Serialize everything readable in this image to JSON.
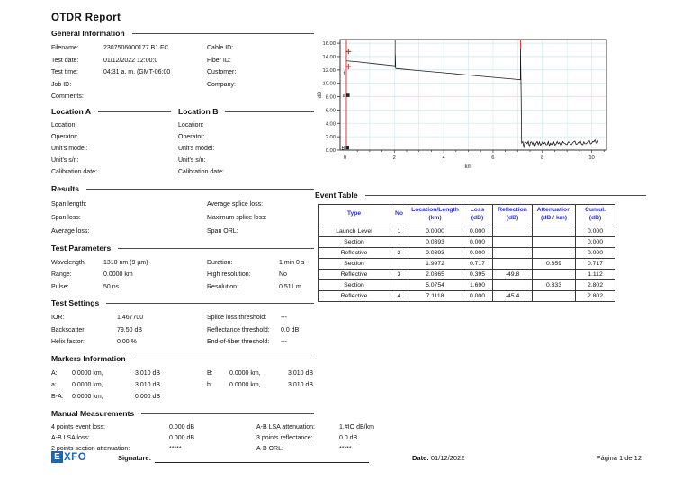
{
  "page": {
    "title": "OTDR  Report"
  },
  "sections": {
    "general": {
      "heading": "General Information",
      "rows": [
        {
          "l1": "Filename:",
          "v1": "2307506000177 B1 FC",
          "l2": "Cable ID:",
          "v2": ""
        },
        {
          "l1": "Test date:",
          "v1": "01/12/2022 12:00:0",
          "l2": "Fiber ID:",
          "v2": ""
        },
        {
          "l1": "Test time:",
          "v1": "04:31 a. m. (GMT-06:00",
          "l2": "Customer:",
          "v2": ""
        },
        {
          "l1": "Job ID:",
          "v1": "",
          "l2": "Company:",
          "v2": ""
        },
        {
          "l1": "Comments:",
          "v1": "",
          "l2": "",
          "v2": ""
        }
      ]
    },
    "location_a": {
      "heading": "Location A",
      "labels": [
        "Location:",
        "Operator:",
        "Unit's model:",
        "Unit's s/n:",
        "Calibration date:"
      ]
    },
    "location_b": {
      "heading": "Location B",
      "labels": [
        "Location:",
        "Operator:",
        "Unit's model:",
        "Unit's s/n:",
        "Calibration date:"
      ]
    },
    "results": {
      "heading": "Results",
      "rows": [
        {
          "l1": "Span length:",
          "l2": "Average splice loss:"
        },
        {
          "l1": "Span loss:",
          "l2": "Maximum splice loss:"
        },
        {
          "l1": "Average loss:",
          "l2": "Span ORL:"
        }
      ]
    },
    "test_parameters": {
      "heading": "Test Parameters",
      "rows": [
        {
          "l1": "Wavelength:",
          "v1": "1310 nm  (9 µm)",
          "l2": "Duration:",
          "v2": "1 min 0 s"
        },
        {
          "l1": "Range:",
          "v1": "0.0000 km",
          "l2": "High resolution:",
          "v2": "No"
        },
        {
          "l1": "Pulse:",
          "v1": "50 ns",
          "l2": "Resolution:",
          "v2": "0.511 m"
        }
      ]
    },
    "test_settings": {
      "heading": "Test Settings",
      "rows": [
        {
          "l1": "IOR:",
          "v1": "1.467700",
          "l2": "Splice loss threshold:",
          "v2": "---"
        },
        {
          "l1": "Backscatter:",
          "v1": "79.50 dB",
          "l2": "Reflectance threshold:",
          "v2": "0.0 dB"
        },
        {
          "l1": "Helix factor:",
          "v1": "0.00 %",
          "l2": "End-of-fiber threshold:",
          "v2": "---"
        }
      ]
    },
    "markers": {
      "heading": "Markers Information",
      "rows": [
        {
          "l1": "A:",
          "v1": "0.0000 km,",
          "v1b": "3.010 dB",
          "l2": "B:",
          "v2": "0.0000 km,",
          "v2b": "3.010 dB"
        },
        {
          "l1": "a:",
          "v1": "0.0000 km,",
          "v1b": "3.010 dB",
          "l2": "b:",
          "v2": "0.0000 km,",
          "v2b": "3.010 dB"
        },
        {
          "l1": "B-A:",
          "v1": "0.0000 km,",
          "v1b": "0.000 dB",
          "l2": "",
          "v2": "",
          "v2b": ""
        }
      ]
    },
    "manual": {
      "heading": "Manual Measurements",
      "rows": [
        {
          "l1": "4 points event loss:",
          "v1": "0.000 dB",
          "l2": "A-B LSA attenuation:",
          "v2": "1.#IO dB/km"
        },
        {
          "l1": "A-B LSA loss:",
          "v1": "0.000 dB",
          "l2": "3 points reflectance:",
          "v2": "0.0 dB"
        },
        {
          "l1": "2 points section attenuation:",
          "v1": "*****",
          "l2": "A-B ORL:",
          "v2": "*****"
        }
      ]
    }
  },
  "event_table": {
    "heading": "Event Table",
    "columns": [
      [
        "Type",
        ""
      ],
      [
        "No",
        ""
      ],
      [
        "Location/Length",
        "(km)"
      ],
      [
        "Loss",
        "(dB)"
      ],
      [
        "Reflection",
        "(dB)"
      ],
      [
        "Attenuation",
        "(dB / km)"
      ],
      [
        "Cumul.",
        "(dB)"
      ]
    ],
    "rows": [
      [
        "Launch Level",
        "1",
        "0.0000",
        "0.000",
        "",
        "",
        "0.000"
      ],
      [
        "Section",
        "",
        "0.0393",
        "0.000",
        "",
        "",
        "0.000"
      ],
      [
        "Reflective",
        "2",
        "0.0393",
        "0.000",
        "",
        "",
        "0.000"
      ],
      [
        "Section",
        "",
        "1.9972",
        "0.717",
        "",
        "0.359",
        "0.717"
      ],
      [
        "Reflective",
        "3",
        "2.0365",
        "0.395",
        "-49.8",
        "",
        "1.112"
      ],
      [
        "Section",
        "",
        "5.0754",
        "1.690",
        "",
        "0.333",
        "2.802"
      ],
      [
        "Reflective",
        "4",
        "7.1118",
        "0.000",
        "-45.4",
        "",
        "2.802"
      ]
    ]
  },
  "chart_data": {
    "type": "line",
    "title": "",
    "xlabel": "km",
    "ylabel": "dB",
    "xlim": [
      -0.2,
      10.6
    ],
    "ylim": [
      0,
      16.55
    ],
    "xticks": [
      0,
      2,
      4,
      6,
      8,
      10
    ],
    "yticks": [
      0,
      2,
      4,
      6,
      8,
      10,
      12,
      14,
      16
    ],
    "ytick_labels": [
      "0.00",
      "2.00",
      "4.00",
      "6.00",
      "8.00",
      "10.00",
      "12.00",
      "14.00",
      "16.00"
    ],
    "grid": "on",
    "grid_color": "#cdeaec",
    "trace_color": "#1a1a1a",
    "event_color": "#e02020",
    "trace_points": [
      [
        0.04,
        13.38
      ],
      [
        0.6,
        13.18
      ],
      [
        1.2,
        12.95
      ],
      [
        1.9972,
        12.63
      ],
      [
        2.0365,
        12.6
      ],
      [
        2.0365,
        14.35
      ],
      [
        2.055,
        12.22
      ],
      [
        3.0,
        11.9
      ],
      [
        4.0,
        11.57
      ],
      [
        5.0,
        11.24
      ],
      [
        6.0,
        10.9
      ],
      [
        7.0,
        10.57
      ],
      [
        7.1118,
        10.53
      ],
      [
        7.1118,
        15.3
      ],
      [
        7.14,
        8.0
      ],
      [
        7.16,
        1.0
      ]
    ],
    "noise": {
      "x_start": 7.16,
      "x_end": 10.3,
      "base": 1.0,
      "amp": 0.55,
      "step": 0.045
    },
    "red_cursor_x": 0.055,
    "red_event_ticks": [
      {
        "x": 2.0365,
        "y1": 14.35,
        "y2": 16.45
      },
      {
        "x": 7.1118,
        "y1": 15.3,
        "y2": 16.45
      }
    ],
    "cross_markers": [
      [
        0.14,
        14.75
      ],
      [
        0.14,
        12.5
      ]
    ],
    "square_markers": [
      {
        "x": 0.12,
        "y": 8.2,
        "label": "a"
      },
      {
        "x": 0.1,
        "y": 0.35,
        "label": "B"
      }
    ],
    "text_markers": [
      {
        "x": 0.06,
        "y": 11.8,
        "text": "1"
      }
    ]
  },
  "footer": {
    "brand_e": "E",
    "brand_rest": "XFO",
    "signature_label": "Signature:",
    "date_label": "Date:",
    "date_value": "01/12/2022",
    "page_label": "Página 1 de 12"
  }
}
